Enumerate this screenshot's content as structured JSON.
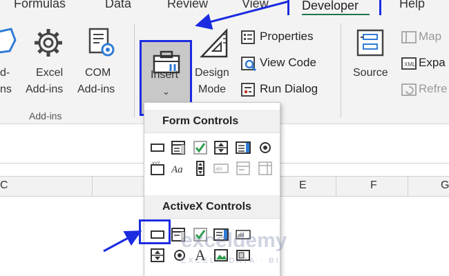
{
  "tabs": {
    "formulas": "Formulas",
    "data": "Data",
    "review": "Review",
    "view": "View",
    "developer": "Developer",
    "help": "Help"
  },
  "ribbon": {
    "addins_partial_top": "d-",
    "addins_partial_bottom": "ns",
    "excel_addins_top": "Excel",
    "excel_addins_bottom": "Add-ins",
    "com_addins_top": "COM",
    "com_addins_bottom": "Add-ins",
    "addins_group_label": "Add-ins",
    "insert_label": "Insert",
    "insert_arrow": "⌄",
    "design_top": "Design",
    "design_bottom": "Mode",
    "properties": "Properties",
    "view_code": "View Code",
    "run_dialog": "Run Dialog",
    "source": "Source",
    "map_partial": "Map",
    "expand_partial": "Expa",
    "refresh_partial": "Refre"
  },
  "columns": [
    "C",
    "E",
    "F",
    "G"
  ],
  "dropdown": {
    "form_controls_title": "Form Controls",
    "activex_controls_title": "ActiveX Controls",
    "form_row1": [
      "button-icon",
      "combo-box-icon",
      "check-box-icon",
      "spin-button-icon",
      "list-box-icon",
      "option-button-icon"
    ],
    "form_row2": [
      "group-box-icon",
      "label-icon",
      "scroll-bar-icon",
      "text-field-icon",
      "combo-list-edit-icon",
      "combo-dropdown-edit-icon"
    ],
    "activex_row1": [
      "command-button-icon",
      "combo-box-icon",
      "check-box-icon",
      "list-box-icon",
      "text-box-icon"
    ],
    "activex_row2": [
      "spin-button-icon",
      "option-button-icon",
      "label-icon",
      "image-icon",
      "toggle-button-icon"
    ]
  },
  "watermark": {
    "brand": "exceldemy",
    "tagline": "EXCEL · DATA · BI"
  },
  "colors": {
    "highlight": "#1b2be0",
    "developer_underline": "#217346",
    "ribbon_bg": "#f3f3f3"
  }
}
